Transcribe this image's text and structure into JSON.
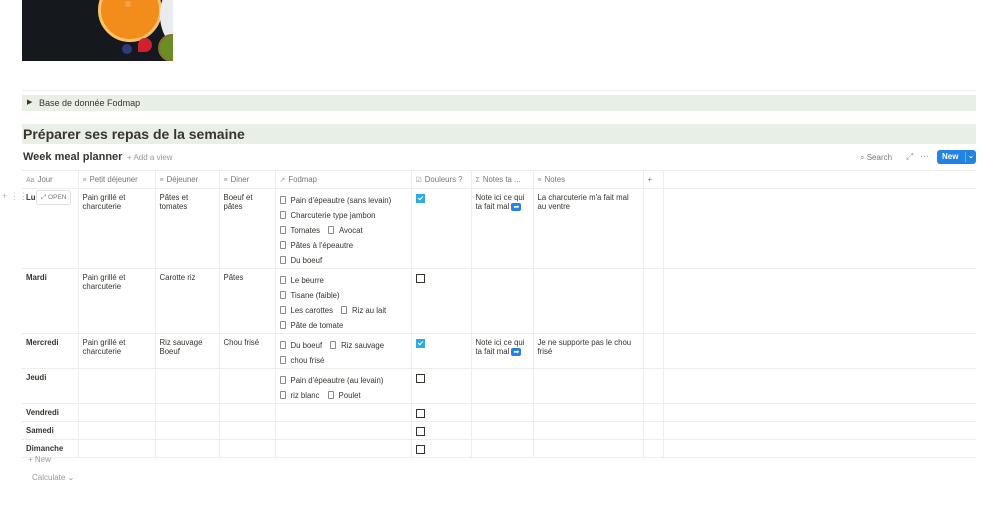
{
  "cover": {
    "alt": "fruits"
  },
  "toggle": {
    "label": "Base de donnée Fodmap",
    "icon": "triangle-right-icon"
  },
  "heading": "Préparer ses repas de la semaine",
  "database": {
    "title": "Week meal planner",
    "add_view": "+ Add a view",
    "search": "Search",
    "new_label": "New",
    "new_row": "+ New",
    "calculate": "Calculate",
    "open_chip": "OPEN",
    "columns": [
      {
        "label": "Jour",
        "icon": "text-icon"
      },
      {
        "label": "Petit déjeuner",
        "icon": "lines-icon"
      },
      {
        "label": "Déjeuner",
        "icon": "lines-icon"
      },
      {
        "label": "Diner",
        "icon": "lines-icon"
      },
      {
        "label": "Fodmap",
        "icon": "relation-arrow-icon"
      },
      {
        "label": "Douleurs ?",
        "icon": "checkbox-icon"
      },
      {
        "label": "Notes ta ...",
        "icon": "sigma-icon"
      },
      {
        "label": "Notes",
        "icon": "lines-icon"
      }
    ],
    "rows": [
      {
        "jour": "Lu",
        "petit": "Pain grillé et charcuterie",
        "dejeuner": "Pâtes et tomates",
        "diner": "Boeuf et pâtes",
        "fodmap": [
          [
            "Pain d'épeautre (sans levain)"
          ],
          [
            "Charcuterie type jambon"
          ],
          [
            "Tomates",
            "Avocat"
          ],
          [
            "Pâtes à l'épeautre"
          ],
          [
            "Du boeuf"
          ]
        ],
        "douleurs": true,
        "notes_ta": "Note ici ce qui ta fait mal",
        "notes": "La charcuterie m'a fait mal au ventre"
      },
      {
        "jour": "Mardi",
        "petit": "Pain grillé et charcuterie",
        "dejeuner": "Carotte riz",
        "diner": "Pâtes",
        "fodmap": [
          [
            "Le beurre"
          ],
          [
            "Tisane (faible)"
          ],
          [
            "Les carottes",
            "Riz au lait"
          ],
          [
            "Pâte de tomate"
          ]
        ],
        "douleurs": false,
        "notes_ta": "",
        "notes": ""
      },
      {
        "jour": "Mercredi",
        "petit": "Pain grillé et charcuterie",
        "dejeuner": "Riz sauvage Boeuf",
        "diner": "Chou frisé",
        "fodmap": [
          [
            "Du boeuf",
            "Riz sauvage"
          ],
          [
            "chou frisé"
          ]
        ],
        "douleurs": true,
        "notes_ta": "Note ici ce qui ta fait mal",
        "notes": "Je ne supporte pas le chou frisé"
      },
      {
        "jour": "Jeudi",
        "petit": "",
        "dejeuner": "",
        "diner": "",
        "fodmap": [
          [
            "Pain d'épeautre (au levain)"
          ],
          [
            "riz blanc",
            "Poulet"
          ]
        ],
        "douleurs": false,
        "notes_ta": "",
        "notes": ""
      },
      {
        "jour": "Vendredi",
        "petit": "",
        "dejeuner": "",
        "diner": "",
        "fodmap": [],
        "douleurs": false,
        "notes_ta": "",
        "notes": ""
      },
      {
        "jour": "Samedi",
        "petit": "",
        "dejeuner": "",
        "diner": "",
        "fodmap": [],
        "douleurs": false,
        "notes_ta": "",
        "notes": ""
      },
      {
        "jour": "Dimanche",
        "petit": "",
        "dejeuner": "",
        "diner": "",
        "fodmap": [],
        "douleurs": false,
        "notes_ta": "",
        "notes": ""
      }
    ]
  },
  "colors": {
    "accent": "#2383e2",
    "checkbox": "#2eaadc",
    "block_bg": "#e8efe6"
  }
}
